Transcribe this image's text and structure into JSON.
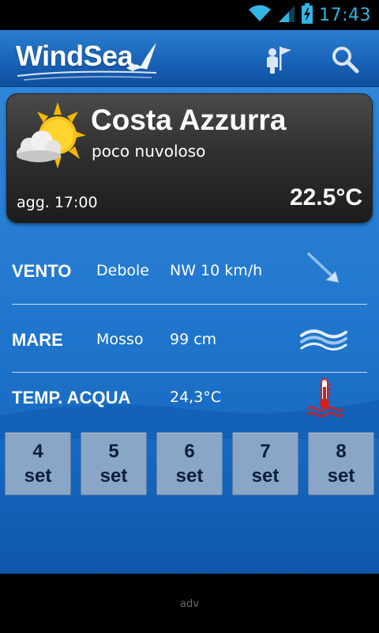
{
  "status_bar": {
    "time": "17:43",
    "icons": [
      "wifi-icon",
      "signal-icon",
      "battery-charging-icon"
    ],
    "time_color": "#33b5e5"
  },
  "app_bar": {
    "logo_text": "WindSea",
    "icons": [
      "map-pin-flag-icon",
      "search-icon"
    ],
    "color": "#1e6fc4"
  },
  "weather": {
    "location": "Costa Azzurra",
    "condition": "poco nuvoloso",
    "updated": "agg. 17:00",
    "temperature": "22.5°C",
    "icon": "sun-behind-cloud-icon"
  },
  "conditions": {
    "wind": {
      "label": "VENTO",
      "strength": "Debole",
      "value": "NW 10 km/h",
      "icon": "wind-arrow-icon"
    },
    "sea": {
      "label": "MARE",
      "state": "Mosso",
      "value": "99 cm",
      "icon": "waves-icon"
    },
    "water_temp": {
      "label": "TEMP. ACQUA",
      "value": "24,3°C",
      "icon": "thermometer-water-icon"
    }
  },
  "days": [
    {
      "day": "4",
      "month": "set"
    },
    {
      "day": "5",
      "month": "set"
    },
    {
      "day": "6",
      "month": "set"
    },
    {
      "day": "7",
      "month": "set"
    },
    {
      "day": "8",
      "month": "set"
    }
  ],
  "footer": {
    "adv": "adv"
  }
}
